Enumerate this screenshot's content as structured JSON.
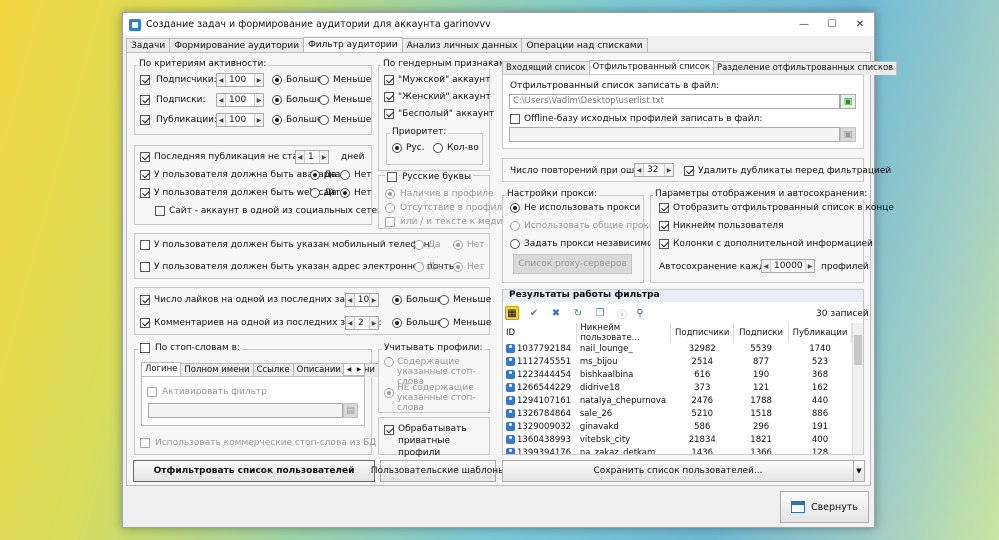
{
  "window": {
    "title": "Создание задач и формирование аудитории для аккаунта garinovvv"
  },
  "tabs": [
    "Задачи",
    "Формирование аудитории",
    "Фильтр аудитории",
    "Анализ личных данных",
    "Операции над списками"
  ],
  "activity": {
    "title": "По критериям активности:",
    "rows": [
      {
        "label": "Подписчики:",
        "value": "100",
        "more": "Больше",
        "less": "Меньше"
      },
      {
        "label": "Подписки:",
        "value": "100",
        "more": "Больше",
        "less": "Меньше"
      },
      {
        "label": "Публикации:",
        "value": "100",
        "more": "Больше",
        "less": "Меньше"
      }
    ]
  },
  "gender": {
    "title": "По гендерным признакам:",
    "male": "\"Мужской\" аккаунт",
    "female": "\"Женский\" аккаунт",
    "neutral": "\"Бесполый\" аккаунт",
    "priority_title": "Приоритет:",
    "pri_rus": "Рус.",
    "pri_count": "Кол-во"
  },
  "pub": {
    "last_pub": "Последняя публикация не старше:",
    "days_value": "1",
    "days": "дней",
    "avatar": "У пользователя должна быть аватарка",
    "website": "У пользователя должен быть web-сайт",
    "site_social": "Сайт - аккаунт в одной из социальных сетей",
    "yes": "Да",
    "no": "Нет"
  },
  "russian": {
    "title": "Русские буквы",
    "in_profile": "Наличие в профиле",
    "absent": "Отсутствие в профиле",
    "or_media": "или / и тексте к медиа"
  },
  "contacts": {
    "phone": "У пользователя должен быть указан мобильный телефон",
    "email": "У пользователя должен быть указан адрес электронной почты",
    "yes": "Да",
    "no": "Нет"
  },
  "likes": {
    "likes_label": "Число лайков на одной из последних записей:",
    "likes_value": "10",
    "comments_label": "Комментариев на одной из последних записей:",
    "comments_value": "2",
    "more": "Больше",
    "less": "Меньше"
  },
  "stopwords": {
    "title": "По стоп-словам в:",
    "tabs": [
      "Логине",
      "Полном имени",
      "Ссылке",
      "Описании страни"
    ],
    "activate": "Активировать фильтр",
    "commercial": "Использовать коммерческие стоп-слова из БД SocialKit"
  },
  "account_profiles": {
    "title": "Учитывать профили:",
    "containing": "Содержащие указанные стоп-слова",
    "not_containing": "НЕ содержащие указанные стоп-слова",
    "private": "Обрабатывать приватные профили"
  },
  "buttons": {
    "filter": "Отфильтровать список пользователей",
    "templates": "Пользовательские шаблоны",
    "save": "Сохранить список пользователей...",
    "collapse": "Свернуть"
  },
  "output": {
    "tabs": [
      "Входящий список",
      "Отфильтрованный список",
      "Разделение отфильтрованных списков"
    ],
    "file_label": "Отфильтрованный список записать в файл:",
    "file_path": "C:\\Users\\Vadim\\Desktop\\userlist.txt",
    "offline_label": "Offline-базу исходных профилей записать в файл:",
    "offline_path": ""
  },
  "retries": {
    "label": "Число повторений при ошибке:",
    "value": "32",
    "remove_dupes": "Удалить дубликаты перед фильтрацией"
  },
  "proxy": {
    "title": "Настройки прокси:",
    "none": "Не использовать прокси",
    "shared": "Использовать общие прокси",
    "own": "Задать прокси независимо",
    "list_btn": "Список proxy-серверов"
  },
  "display": {
    "title": "Параметры отображения и автосохранения:",
    "show_end": "Отобразить отфильтрованный список в конце",
    "nick": "Никнейм пользователя",
    "columns": "Колонки с дополнительной информацией",
    "autosave": "Автосохранение каждые",
    "autosave_value": "10000",
    "profiles": "профилей"
  },
  "results": {
    "title": "Результаты работы фильтра",
    "count": "30 записей",
    "columns": [
      "ID",
      "Никнейм пользовате...",
      "Подписчики",
      "Подписки",
      "Публикации"
    ],
    "rows": [
      [
        "1037792184",
        "nail_lounge_",
        "32982",
        "5539",
        "1740"
      ],
      [
        "1112745551",
        "ms_bijou",
        "2514",
        "877",
        "523"
      ],
      [
        "1223444454",
        "bishkaalbina",
        "616",
        "190",
        "368"
      ],
      [
        "1266544229",
        "didrive18",
        "373",
        "121",
        "162"
      ],
      [
        "1294107161",
        "natalya_chepurnova",
        "2476",
        "1788",
        "440"
      ],
      [
        "1326784864",
        "sale_26",
        "5210",
        "1518",
        "886"
      ],
      [
        "1329009032",
        "ginavakd",
        "586",
        "296",
        "191"
      ],
      [
        "1360438993",
        "vitebsk_city",
        "21834",
        "1821",
        "400"
      ],
      [
        "1399394176",
        "na_zakaz_detkam",
        "1436",
        "1366",
        "128"
      ]
    ]
  }
}
